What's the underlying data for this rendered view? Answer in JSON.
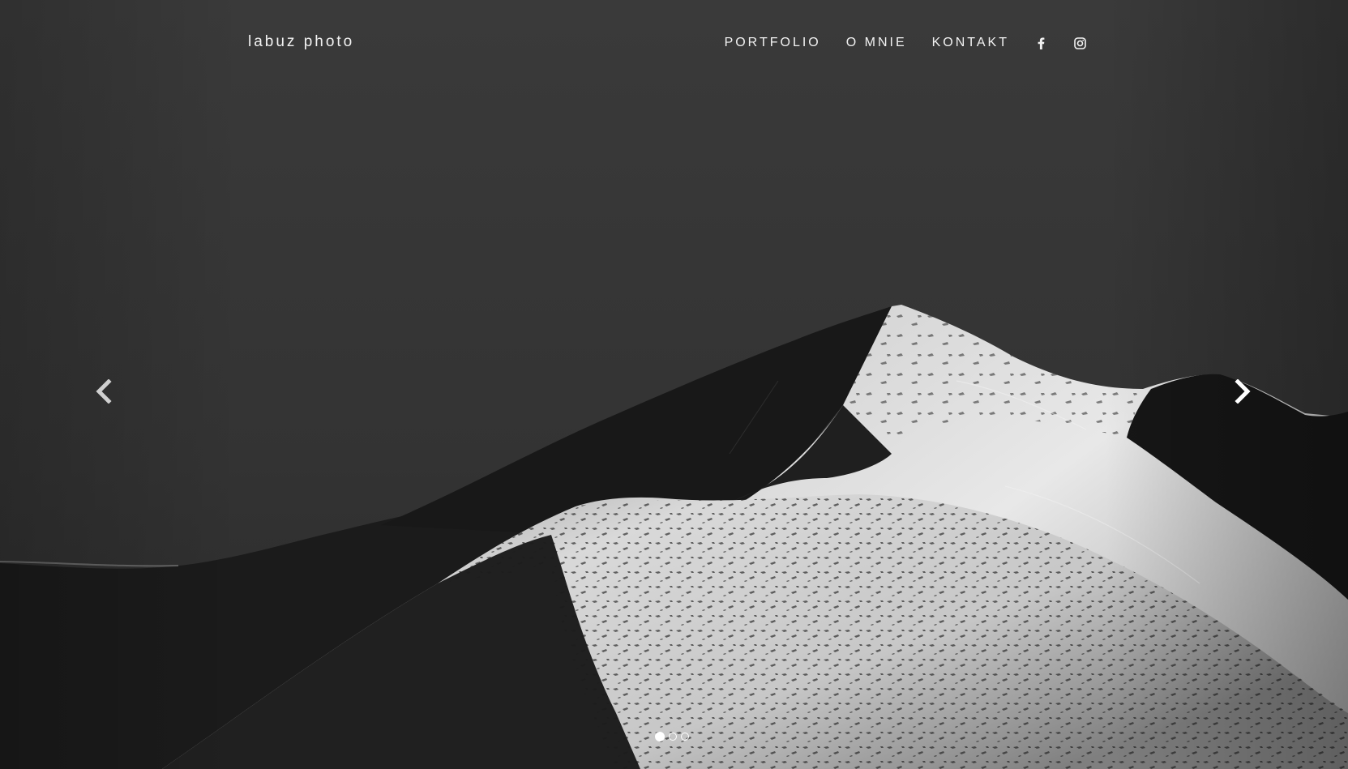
{
  "brand": {
    "name": "labuz photo"
  },
  "nav": {
    "items": [
      {
        "label": "PORTFOLIO"
      },
      {
        "label": "O MNIE"
      },
      {
        "label": "KONTAKT"
      }
    ],
    "social": [
      {
        "icon": "facebook-icon"
      },
      {
        "icon": "instagram-icon"
      }
    ]
  },
  "carousel": {
    "slide_count": 3,
    "active_index": 0,
    "prev_icon": "chevron-left-icon",
    "next_icon": "chevron-right-icon"
  },
  "colors": {
    "text": "#f2f2f2",
    "sky": "#333333",
    "snow": "#e6e6e6",
    "shadow": "#151515"
  }
}
